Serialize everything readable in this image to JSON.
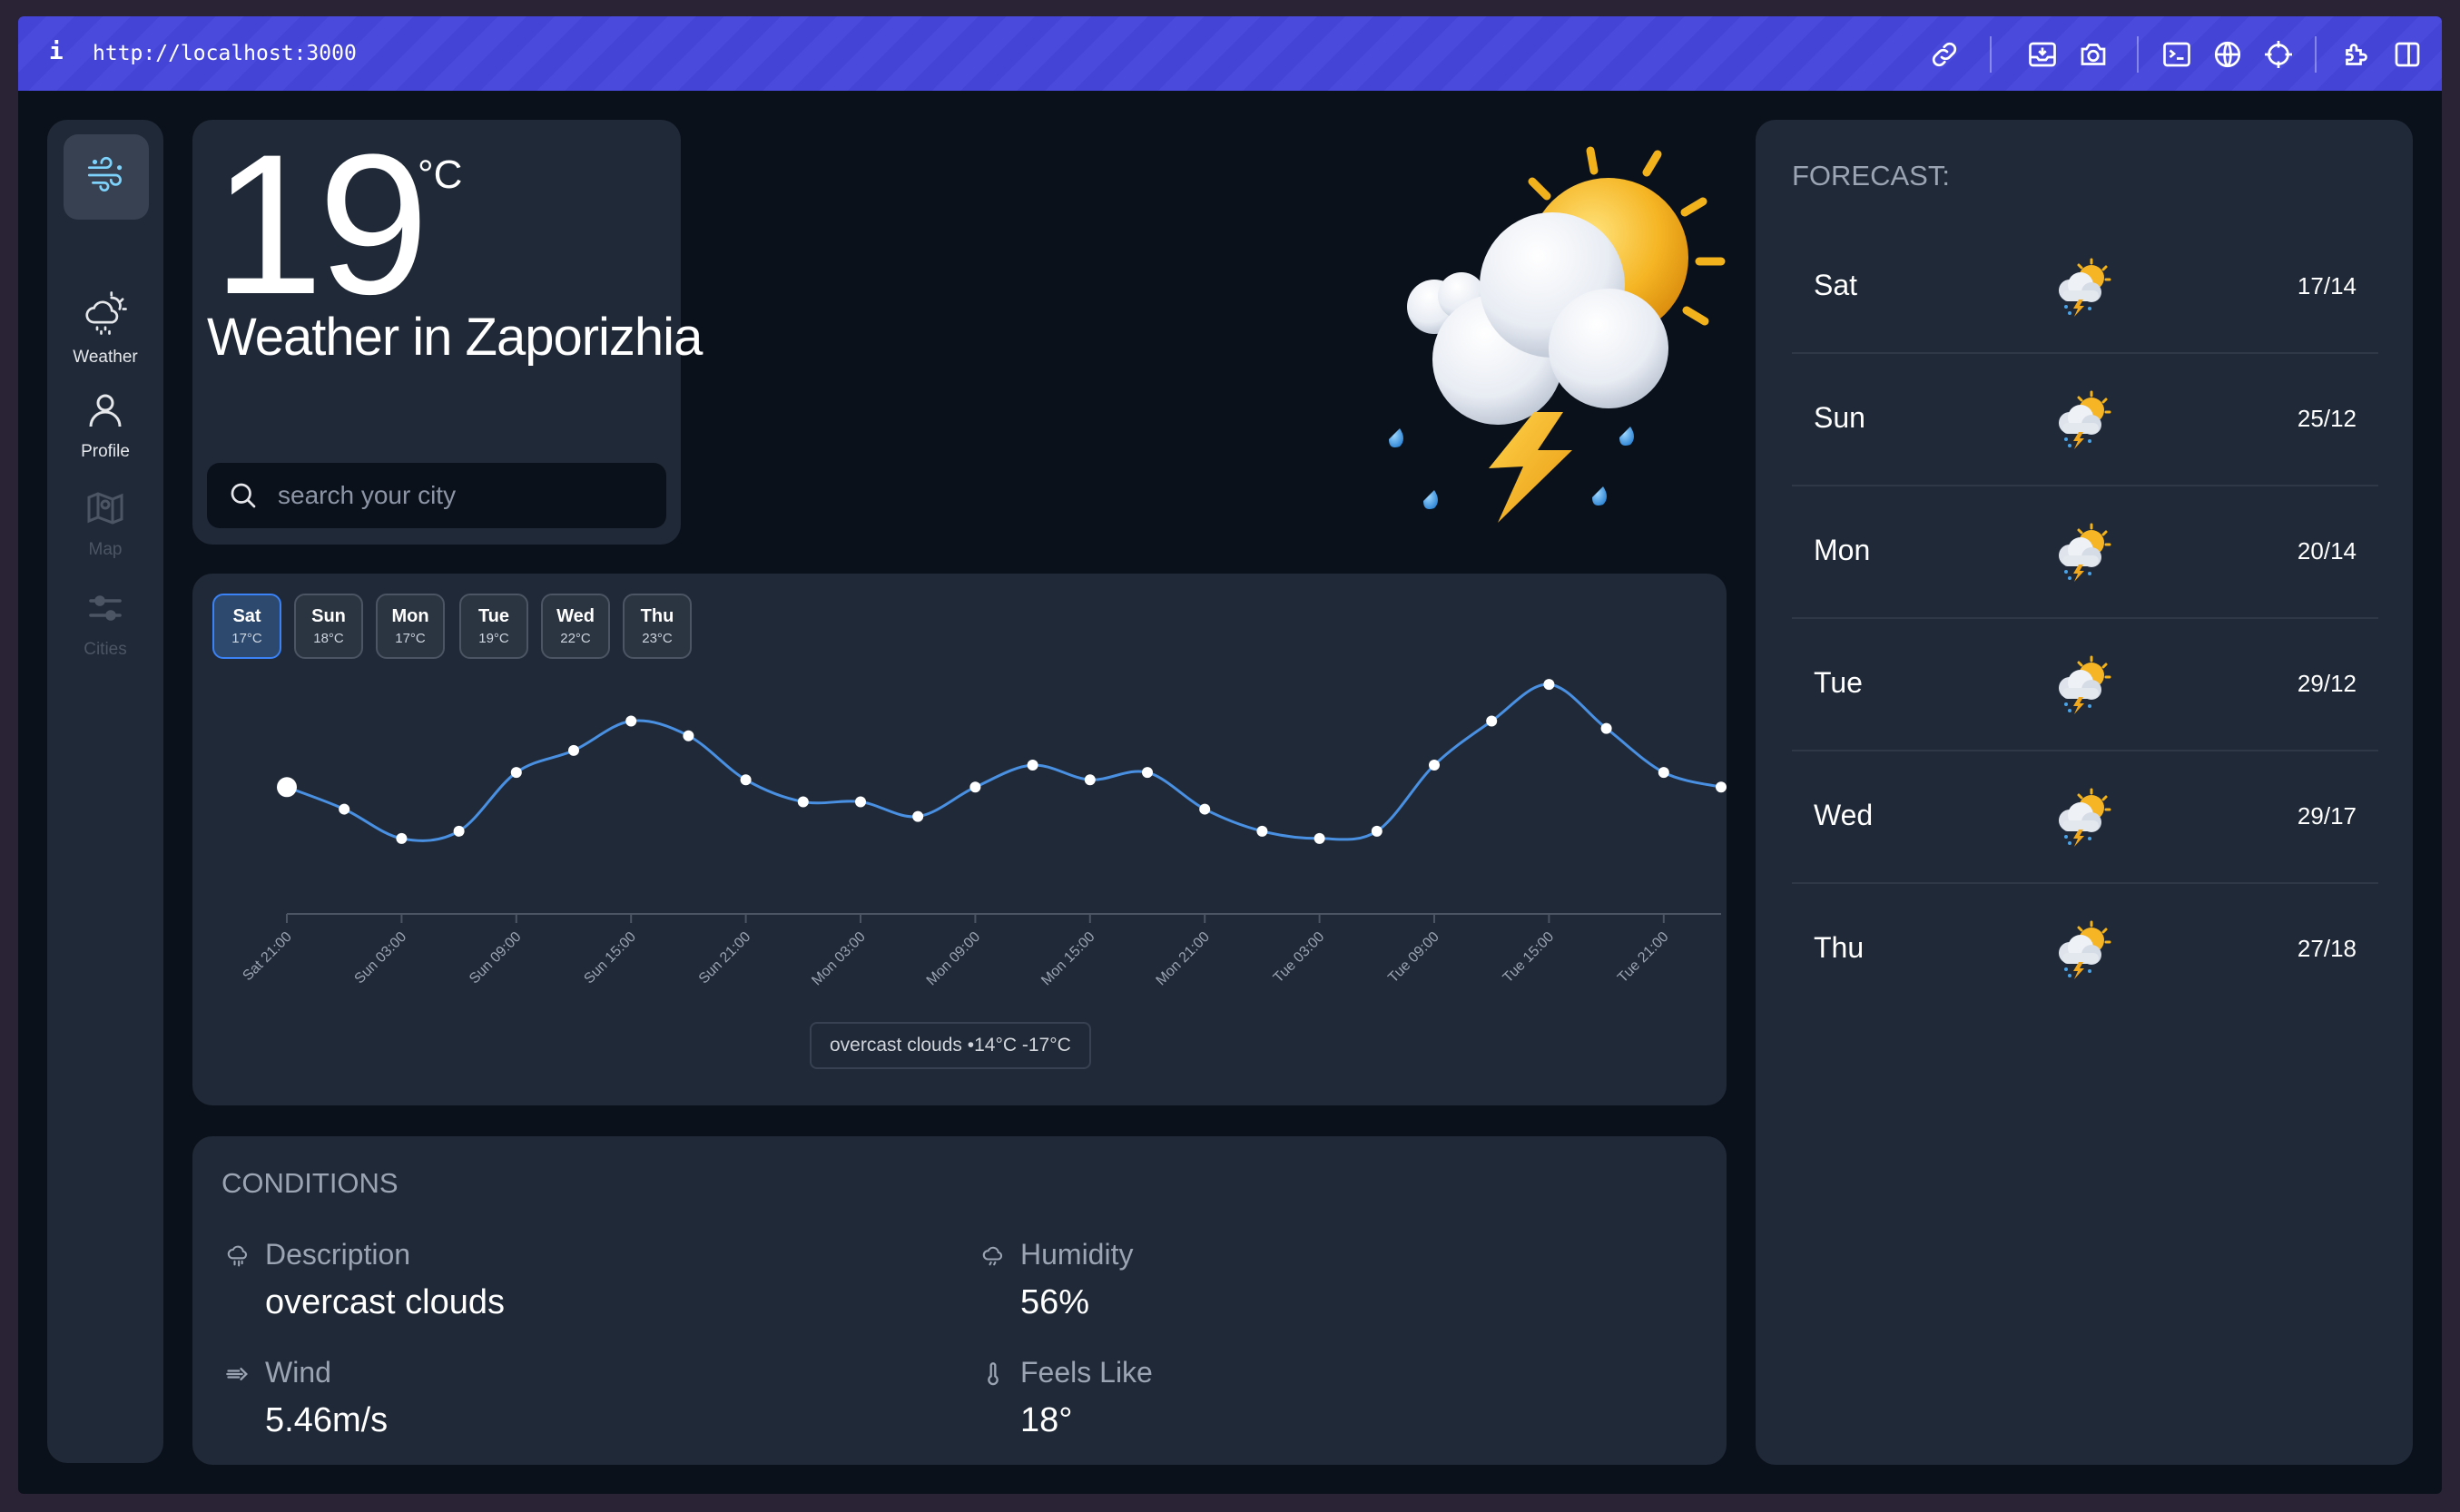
{
  "browser": {
    "info_glyph": "i",
    "url": "http://localhost:3000",
    "toolbar_icons": [
      "link-icon",
      "inbox-tray-icon",
      "camera-icon",
      "terminal-icon",
      "globe-icon",
      "crosshair-icon",
      "extensions-icon",
      "split-view-icon"
    ]
  },
  "sidebar": {
    "logo_icon": "wind-icon",
    "items": [
      {
        "label": "Weather",
        "icon": "cloud-sun-icon",
        "active": true
      },
      {
        "label": "Profile",
        "icon": "user-icon",
        "active": true
      },
      {
        "label": "Map",
        "icon": "map-icon",
        "active": false
      },
      {
        "label": "Cities",
        "icon": "sliders-icon",
        "active": false
      }
    ]
  },
  "current": {
    "temp": "19",
    "unit": "°C",
    "title": "Weather in Zaporizhia",
    "weather_icon": "thunderstorm-sun-icon"
  },
  "search": {
    "placeholder": "search your city",
    "value": ""
  },
  "days": [
    {
      "name": "Sat",
      "temp": "17°C",
      "active": true
    },
    {
      "name": "Sun",
      "temp": "18°C",
      "active": false
    },
    {
      "name": "Mon",
      "temp": "17°C",
      "active": false
    },
    {
      "name": "Tue",
      "temp": "19°C",
      "active": false
    },
    {
      "name": "Wed",
      "temp": "22°C",
      "active": false
    },
    {
      "name": "Thu",
      "temp": "23°C",
      "active": false
    }
  ],
  "chart_data": {
    "type": "line",
    "title": "",
    "xlabel": "",
    "ylabel": "",
    "tick_labels": [
      "Sat 21:00",
      "Sun 03:00",
      "Sun 09:00",
      "Sun 15:00",
      "Sun 21:00",
      "Mon 03:00",
      "Mon 09:00",
      "Mon 15:00",
      "Mon 21:00",
      "Tue 03:00",
      "Tue 09:00",
      "Tue 15:00",
      "Tue 21:00"
    ],
    "x": [
      "Sat 21:00",
      "Sun 00:00",
      "Sun 03:00",
      "Sun 06:00",
      "Sun 09:00",
      "Sun 12:00",
      "Sun 15:00",
      "Sun 18:00",
      "Sun 21:00",
      "Mon 00:00",
      "Mon 03:00",
      "Mon 06:00",
      "Mon 09:00",
      "Mon 12:00",
      "Mon 15:00",
      "Mon 18:00",
      "Mon 21:00",
      "Tue 00:00",
      "Tue 03:00",
      "Tue 06:00",
      "Tue 09:00",
      "Tue 12:00",
      "Tue 15:00",
      "Tue 18:00",
      "Tue 21:00",
      "Wed 00:00"
    ],
    "values": [
      17.0,
      16.7,
      16.3,
      16.4,
      17.2,
      17.5,
      17.9,
      17.7,
      17.1,
      16.8,
      16.8,
      16.6,
      17.0,
      17.3,
      17.1,
      17.2,
      16.7,
      16.4,
      16.3,
      16.4,
      17.3,
      17.9,
      18.4,
      17.8,
      17.2,
      17.0
    ],
    "grid": false,
    "tooltip": "overcast clouds •14°C -17°C"
  },
  "conditions": {
    "title": "CONDITIONS",
    "items": [
      {
        "label": "Description",
        "value": "overcast clouds",
        "icon": "cloud-rain-icon"
      },
      {
        "label": "Humidity",
        "value": "56%",
        "icon": "cloud-drizzle-icon"
      },
      {
        "label": "Wind",
        "value": "5.46m/s",
        "icon": "wind-arrow-icon"
      },
      {
        "label": "Feels Like",
        "value": "18°",
        "icon": "thermometer-icon"
      }
    ]
  },
  "forecast": {
    "title": "FORECAST:",
    "items": [
      {
        "day": "Sat",
        "temps": "17/14",
        "icon": "thunderstorm-sun-icon"
      },
      {
        "day": "Sun",
        "temps": "25/12",
        "icon": "thunderstorm-sun-icon"
      },
      {
        "day": "Mon",
        "temps": "20/14",
        "icon": "thunderstorm-sun-icon"
      },
      {
        "day": "Tue",
        "temps": "29/12",
        "icon": "thunderstorm-sun-icon"
      },
      {
        "day": "Wed",
        "temps": "29/17",
        "icon": "thunderstorm-sun-icon"
      },
      {
        "day": "Thu",
        "temps": "27/18",
        "icon": "thunderstorm-sun-icon"
      }
    ]
  }
}
